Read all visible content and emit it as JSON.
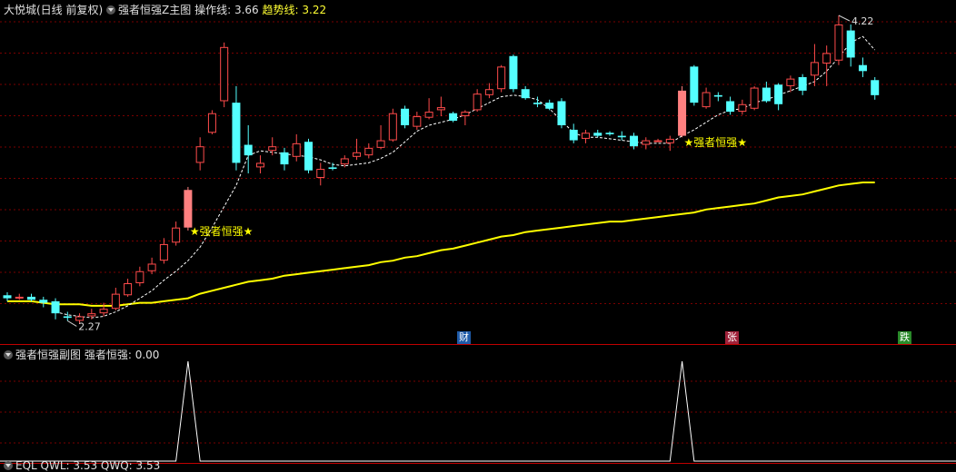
{
  "header": {
    "stock_name": "大悦城(日线 前复权)",
    "indicator_name": "强者恒强Z主图",
    "op_line_label": "操作线:",
    "op_line_value": "3.66",
    "trend_line_label": "趋势线:",
    "trend_line_value": "3.22"
  },
  "sub_header": {
    "indicator_name": "强者恒强副图",
    "value_label": "强者恒强:",
    "value": "0.00"
  },
  "bottom_header": {
    "text": "EQL  QWL: 3.53  QWQ: 3.53"
  },
  "markers": [
    {
      "label": "财",
      "color": "#1e5aa8"
    },
    {
      "label": "张",
      "color": "#a0223a"
    },
    {
      "label": "跌",
      "color": "#2a8a2a"
    }
  ],
  "annotations": {
    "high_label": "4.22",
    "low_label": "2.27",
    "signal_1": "★强者恒强★",
    "signal_2": "★强者恒强★"
  },
  "colors": {
    "up": "#ff4b4b",
    "down": "#54ffff",
    "signal_candle": "#ff8080",
    "trend_line": "#ffff00",
    "op_line": "#ffffff",
    "grid": "#7a0000",
    "divider": "#c00000"
  },
  "chart_data": {
    "type": "candlestick",
    "y_range_main": [
      2.17,
      4.33
    ],
    "candles": [
      [
        2.47,
        2.45,
        2.49,
        2.43
      ],
      [
        2.45,
        2.46,
        2.48,
        2.44
      ],
      [
        2.46,
        2.44,
        2.48,
        2.43
      ],
      [
        2.44,
        2.42,
        2.46,
        2.39
      ],
      [
        2.43,
        2.35,
        2.45,
        2.31
      ],
      [
        2.33,
        2.32,
        2.36,
        2.3
      ],
      [
        2.3,
        2.33,
        2.35,
        2.28
      ],
      [
        2.33,
        2.35,
        2.38,
        2.31
      ],
      [
        2.35,
        2.38,
        2.42,
        2.33
      ],
      [
        2.38,
        2.48,
        2.52,
        2.37
      ],
      [
        2.47,
        2.55,
        2.58,
        2.46
      ],
      [
        2.55,
        2.63,
        2.66,
        2.53
      ],
      [
        2.63,
        2.68,
        2.72,
        2.61
      ],
      [
        2.7,
        2.81,
        2.85,
        2.68
      ],
      [
        2.82,
        2.92,
        2.96,
        2.8
      ],
      [
        2.92,
        3.17,
        3.19,
        2.9
      ],
      [
        3.35,
        3.46,
        3.52,
        3.3
      ],
      [
        3.55,
        3.68,
        3.7,
        3.54
      ],
      [
        3.76,
        4.12,
        4.15,
        3.72
      ],
      [
        3.75,
        3.35,
        3.86,
        3.3
      ],
      [
        3.47,
        3.4,
        3.6,
        3.28
      ],
      [
        3.32,
        3.35,
        3.4,
        3.28
      ],
      [
        3.43,
        3.46,
        3.52,
        3.4
      ],
      [
        3.42,
        3.34,
        3.45,
        3.3
      ],
      [
        3.39,
        3.48,
        3.54,
        3.36
      ],
      [
        3.49,
        3.3,
        3.51,
        3.28
      ],
      [
        3.25,
        3.31,
        3.35,
        3.2
      ],
      [
        3.32,
        3.31,
        3.35,
        3.3
      ],
      [
        3.34,
        3.38,
        3.4,
        3.32
      ],
      [
        3.39,
        3.42,
        3.51,
        3.37
      ],
      [
        3.4,
        3.45,
        3.48,
        3.38
      ],
      [
        3.45,
        3.5,
        3.6,
        3.44
      ],
      [
        3.5,
        3.68,
        3.71,
        3.49
      ],
      [
        3.71,
        3.6,
        3.73,
        3.58
      ],
      [
        3.59,
        3.66,
        3.69,
        3.57
      ],
      [
        3.65,
        3.69,
        3.78,
        3.64
      ],
      [
        3.7,
        3.72,
        3.79,
        3.66
      ],
      [
        3.68,
        3.63,
        3.69,
        3.62
      ],
      [
        3.66,
        3.69,
        3.7,
        3.6
      ],
      [
        3.7,
        3.81,
        3.84,
        3.69
      ],
      [
        3.8,
        3.84,
        3.88,
        3.78
      ],
      [
        3.84,
        3.99,
        4.0,
        3.82
      ],
      [
        4.06,
        3.84,
        4.07,
        3.82
      ],
      [
        3.84,
        3.78,
        3.86,
        3.77
      ],
      [
        3.75,
        3.74,
        3.79,
        3.72
      ],
      [
        3.75,
        3.71,
        3.77,
        3.7
      ],
      [
        3.76,
        3.6,
        3.78,
        3.58
      ],
      [
        3.57,
        3.5,
        3.61,
        3.48
      ],
      [
        3.51,
        3.55,
        3.57,
        3.48
      ],
      [
        3.55,
        3.53,
        3.57,
        3.52
      ],
      [
        3.55,
        3.54,
        3.56,
        3.53
      ],
      [
        3.53,
        3.52,
        3.56,
        3.5
      ],
      [
        3.53,
        3.46,
        3.55,
        3.44
      ],
      [
        3.47,
        3.5,
        3.52,
        3.44
      ],
      [
        3.49,
        3.5,
        3.51,
        3.49
      ],
      [
        3.48,
        3.51,
        3.53,
        3.43
      ],
      [
        3.53,
        3.83,
        3.86,
        3.52
      ],
      [
        3.99,
        3.75,
        4.0,
        3.73
      ],
      [
        3.72,
        3.82,
        3.85,
        3.71
      ],
      [
        3.8,
        3.79,
        3.82,
        3.76
      ],
      [
        3.76,
        3.69,
        3.79,
        3.67
      ],
      [
        3.69,
        3.74,
        3.77,
        3.67
      ],
      [
        3.71,
        3.85,
        3.86,
        3.7
      ],
      [
        3.85,
        3.76,
        3.89,
        3.75
      ],
      [
        3.87,
        3.74,
        3.88,
        3.7
      ],
      [
        3.86,
        3.91,
        3.93,
        3.82
      ],
      [
        3.92,
        3.83,
        3.94,
        3.8
      ],
      [
        3.93,
        4.02,
        4.14,
        3.86
      ],
      [
        4.01,
        4.08,
        4.13,
        3.86
      ],
      [
        4.03,
        4.27,
        4.33,
        4.0
      ],
      [
        4.23,
        4.05,
        4.27,
        3.99
      ],
      [
        4.0,
        3.96,
        4.05,
        3.92
      ],
      [
        3.9,
        3.8,
        3.92,
        3.77
      ]
    ],
    "signal_candle_indices": [
      15,
      56
    ],
    "trend_line": [
      2.43,
      2.43,
      2.43,
      2.42,
      2.41,
      2.41,
      2.41,
      2.4,
      2.4,
      2.4,
      2.41,
      2.42,
      2.42,
      2.43,
      2.44,
      2.45,
      2.48,
      2.5,
      2.52,
      2.54,
      2.56,
      2.57,
      2.58,
      2.6,
      2.61,
      2.62,
      2.63,
      2.64,
      2.65,
      2.66,
      2.67,
      2.69,
      2.7,
      2.72,
      2.73,
      2.75,
      2.77,
      2.78,
      2.8,
      2.82,
      2.84,
      2.86,
      2.87,
      2.89,
      2.9,
      2.91,
      2.92,
      2.93,
      2.94,
      2.95,
      2.96,
      2.96,
      2.97,
      2.98,
      2.99,
      3.0,
      3.01,
      3.02,
      3.04,
      3.05,
      3.06,
      3.07,
      3.08,
      3.1,
      3.12,
      3.13,
      3.14,
      3.16,
      3.18,
      3.2,
      3.21,
      3.22,
      3.22
    ],
    "op_line": [
      null,
      null,
      null,
      null,
      2.36,
      2.34,
      2.33,
      2.32,
      2.33,
      2.36,
      2.4,
      2.45,
      2.5,
      2.57,
      2.63,
      2.7,
      2.79,
      2.92,
      3.06,
      3.2,
      3.4,
      3.43,
      3.42,
      3.41,
      3.4,
      3.39,
      3.37,
      3.34,
      3.33,
      3.34,
      3.35,
      3.38,
      3.42,
      3.49,
      3.56,
      3.6,
      3.62,
      3.64,
      3.67,
      3.71,
      3.75,
      3.79,
      3.8,
      3.79,
      3.77,
      3.71,
      3.63,
      3.55,
      3.52,
      3.52,
      3.51,
      3.5,
      3.49,
      3.48,
      3.48,
      3.48,
      3.53,
      3.57,
      3.62,
      3.67,
      3.7,
      3.71,
      3.75,
      3.77,
      3.8,
      3.83,
      3.86,
      3.89,
      3.96,
      4.05,
      4.15,
      4.19,
      4.1
    ],
    "sub_chart": {
      "type": "line",
      "y_range": [
        0,
        1
      ],
      "values": [
        0,
        0,
        0,
        0,
        0,
        0,
        0,
        0,
        0,
        0,
        0,
        0,
        0,
        0,
        0,
        1,
        0,
        0,
        0,
        0,
        0,
        0,
        0,
        0,
        0,
        0,
        0,
        0,
        0,
        0,
        0,
        0,
        0,
        0,
        0,
        0,
        0,
        0,
        0,
        0,
        0,
        0,
        0,
        0,
        0,
        0,
        0,
        0,
        0,
        0,
        0,
        0,
        0,
        0,
        0,
        0,
        1,
        0,
        0,
        0,
        0,
        0,
        0,
        0,
        0,
        0,
        0,
        0,
        0,
        0,
        0,
        0,
        0
      ]
    }
  }
}
